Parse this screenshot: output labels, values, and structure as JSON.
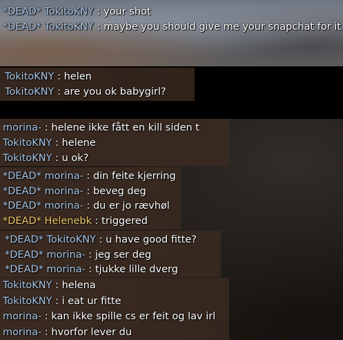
{
  "colors": {
    "player_name": "#a9c6e8",
    "player_name_gold": "#f0c96a",
    "message": "#ffffff"
  },
  "groups": [
    {
      "lines": [
        {
          "prefix": "*DEAD*",
          "name": "TokitoKNY",
          "sep": " : ",
          "text": "your shot",
          "team": "blue"
        },
        {
          "prefix": "*DEAD*",
          "name": "TokitoKNY",
          "sep": " : ",
          "text": "maybe you should give me your snapchat for it",
          "team": "blue"
        }
      ]
    },
    {
      "lines": [
        {
          "prefix": "",
          "name": "TokitoKNY",
          "sep": " : ",
          "text": "helen",
          "team": "blue"
        },
        {
          "prefix": "",
          "name": "TokitoKNY",
          "sep": " : ",
          "text": "are you ok babygirl?",
          "team": "blue"
        }
      ]
    },
    {
      "lines": [
        {
          "prefix": "",
          "name": "morina-",
          "sep": " : ",
          "text": "helene ikke fått en kill siden t",
          "team": "blue"
        },
        {
          "prefix": "",
          "name": "TokitoKNY",
          "sep": " : ",
          "text": "helene",
          "team": "blue"
        },
        {
          "prefix": "",
          "name": "TokitoKNY",
          "sep": " : ",
          "text": "u ok?",
          "team": "blue"
        }
      ]
    },
    {
      "lines": [
        {
          "prefix": "*DEAD*",
          "name": "morina-",
          "sep": " : ",
          "text": "din feite kjerring",
          "team": "blue"
        },
        {
          "prefix": "*DEAD*",
          "name": "morina-",
          "sep": " : ",
          "text": "beveg deg",
          "team": "blue"
        },
        {
          "prefix": "*DEAD*",
          "name": "morina-",
          "sep": " : ",
          "text": "du er jo rævhøl",
          "team": "blue"
        },
        {
          "prefix": "*DEAD*",
          "name": "Helenebk",
          "sep": " : ",
          "text": "triggered",
          "team": "gold"
        }
      ]
    },
    {
      "lines": [
        {
          "prefix": "*DEAD*",
          "name": "TokitoKNY",
          "sep": " : ",
          "text": "u have good fitte?",
          "team": "blue"
        },
        {
          "prefix": "*DEAD*",
          "name": "morina-",
          "sep": " : ",
          "text": "jeg ser deg",
          "team": "blue"
        },
        {
          "prefix": "*DEAD*",
          "name": "morina-",
          "sep": " : ",
          "text": "tjukke lille dverg",
          "team": "blue"
        }
      ]
    },
    {
      "lines": [
        {
          "prefix": "",
          "name": "TokitoKNY",
          "sep": " : ",
          "text": "helena",
          "team": "blue"
        },
        {
          "prefix": "",
          "name": "TokitoKNY",
          "sep": " : ",
          "text": "i eat ur fitte",
          "team": "blue"
        },
        {
          "prefix": "",
          "name": "morina-",
          "sep": " : ",
          "text": "kan ikke spille cs er feit og lav irl",
          "team": "blue"
        },
        {
          "prefix": "",
          "name": "morina-",
          "sep": " : ",
          "text": "hvorfor lever du",
          "team": "blue"
        }
      ]
    }
  ]
}
